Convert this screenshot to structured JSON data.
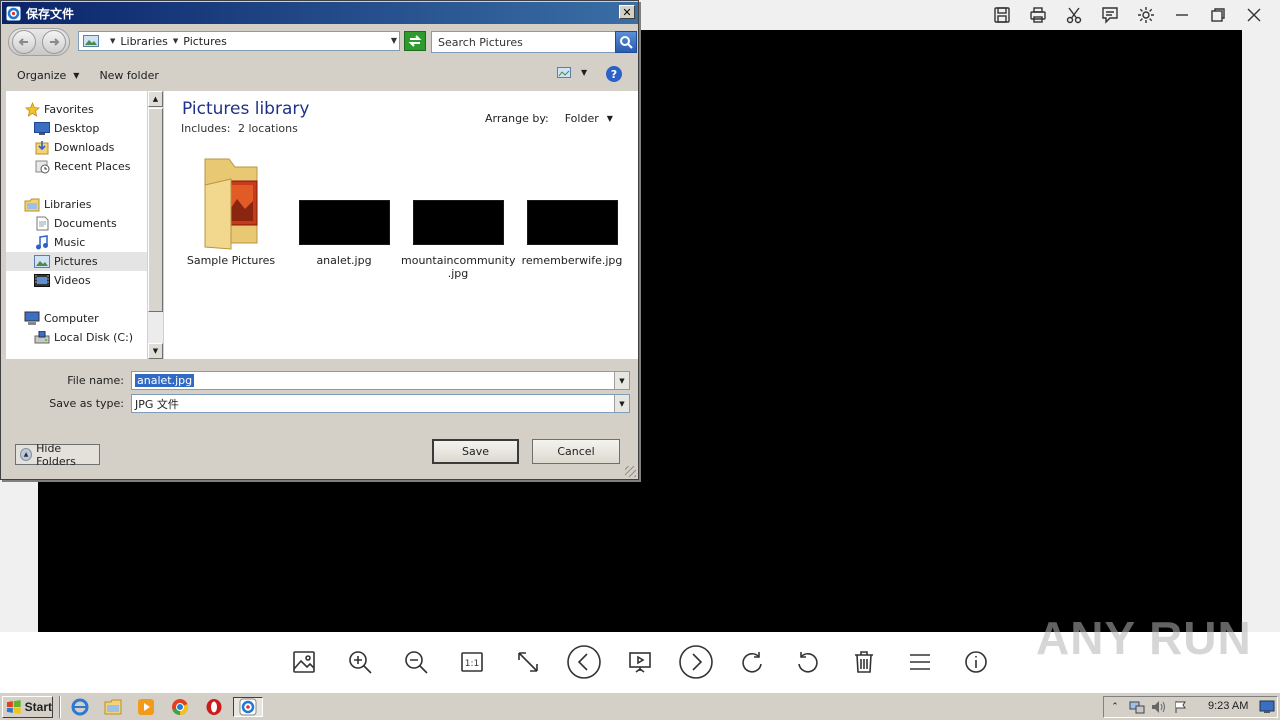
{
  "dialog": {
    "title": "保存文件",
    "address": {
      "crumbs": [
        "Libraries",
        "Pictures"
      ]
    },
    "search_placeholder": "Search Pictures",
    "toolbar": {
      "organize": "Organize",
      "new_folder": "New folder"
    },
    "nav": {
      "items": [
        {
          "label": "Favorites",
          "icon": "star-icon"
        },
        {
          "label": "Desktop",
          "icon": "desktop-icon"
        },
        {
          "label": "Downloads",
          "icon": "downloads-icon"
        },
        {
          "label": "Recent Places",
          "icon": "recent-places-icon"
        },
        {
          "label": "Libraries",
          "icon": "libraries-icon"
        },
        {
          "label": "Documents",
          "icon": "documents-icon"
        },
        {
          "label": "Music",
          "icon": "music-icon"
        },
        {
          "label": "Pictures",
          "icon": "pictures-icon",
          "selected": true
        },
        {
          "label": "Videos",
          "icon": "videos-icon"
        },
        {
          "label": "Computer",
          "icon": "computer-icon"
        },
        {
          "label": "Local Disk (C:)",
          "icon": "local-disk-icon"
        }
      ]
    },
    "library": {
      "title": "Pictures library",
      "includes_label": "Includes:",
      "includes_link": "2 locations",
      "arrange_label": "Arrange by:",
      "arrange_value": "Folder"
    },
    "files": [
      {
        "name": "Sample Pictures",
        "kind": "folder"
      },
      {
        "name": "analet.jpg",
        "kind": "image"
      },
      {
        "name": "mountaincommunity\n.jpg",
        "kind": "image"
      },
      {
        "name": "rememberwife.jpg",
        "kind": "image"
      }
    ],
    "filename_label": "File name:",
    "filename_value": "analet.jpg",
    "savetype_label": "Save as type:",
    "savetype_value": "JPG 文件",
    "hide_folders": "Hide Folders",
    "save": "Save",
    "cancel": "Cancel"
  },
  "viewer": {
    "top_tools": [
      "save-icon",
      "print-icon",
      "cut-icon",
      "comment-icon",
      "settings-icon",
      "minimize-icon",
      "restore-icon",
      "close-icon"
    ],
    "bottom_tools": [
      "image-icon",
      "zoom-in-icon",
      "zoom-out-icon",
      "actual-size-icon",
      "fullscreen-icon",
      "previous-icon",
      "slideshow-icon",
      "next-icon",
      "rotate-right-icon",
      "rotate-left-icon",
      "delete-icon",
      "menu-icon",
      "info-icon"
    ],
    "actual_size_label": "1:1",
    "watermark": "ANY RUN"
  },
  "taskbar": {
    "start": "Start",
    "clock": "9:23 AM"
  },
  "colors": {
    "title_gradient_start": "#0a246a",
    "title_gradient_end": "#3a6ea5",
    "library_title": "#1e3287",
    "selection": "#316ac5"
  }
}
